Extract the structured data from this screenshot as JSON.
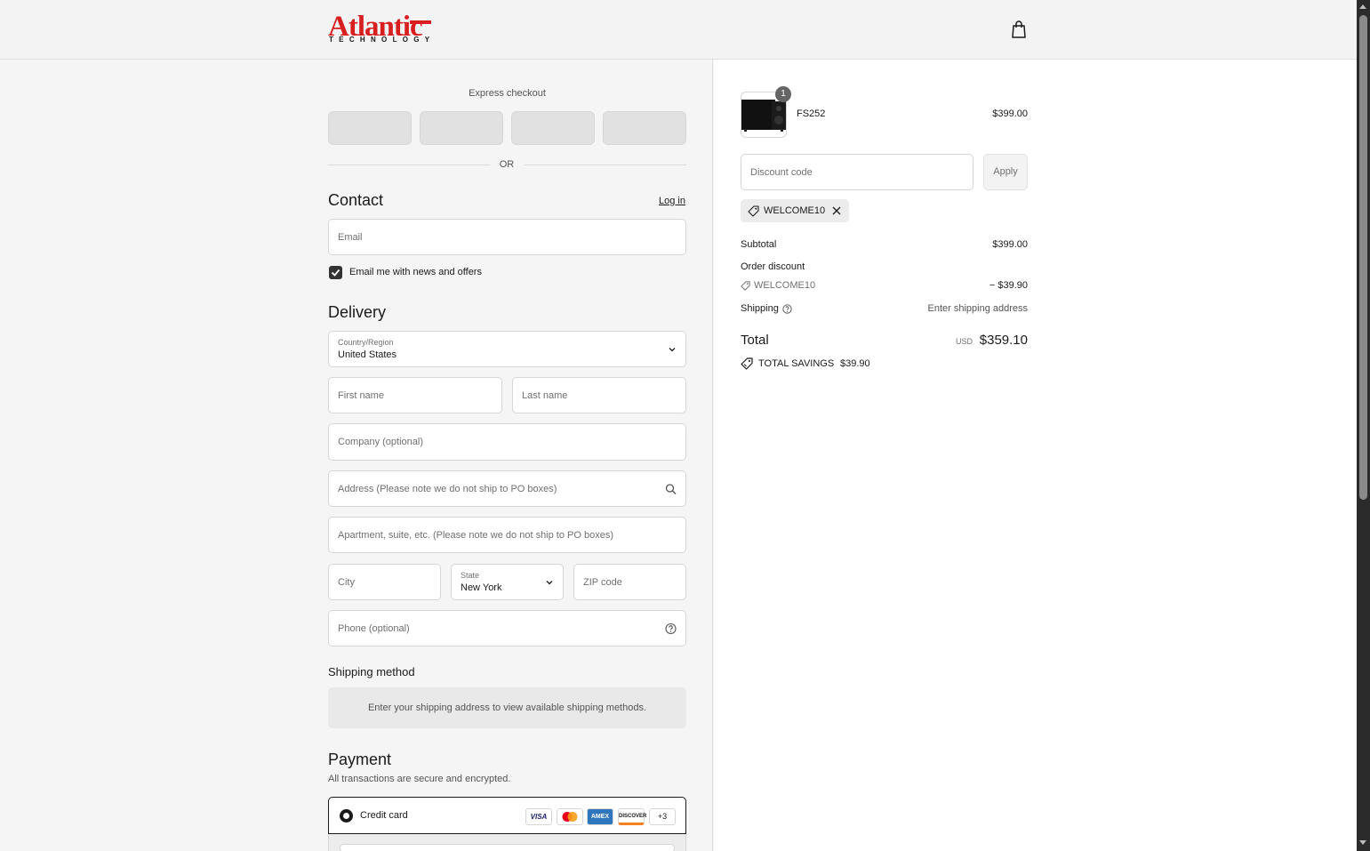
{
  "brand": {
    "name": "Atlantic",
    "tagline": "TECHNOLOGY"
  },
  "express": {
    "title": "Express checkout",
    "separator": "OR"
  },
  "contact": {
    "heading": "Contact",
    "login_link": "Log in",
    "email_placeholder": "Email",
    "newsletter_label": "Email me with news and offers",
    "newsletter_checked": true
  },
  "delivery": {
    "heading": "Delivery",
    "country_label": "Country/Region",
    "country_value": "United States",
    "first_name": "First name",
    "last_name": "Last name",
    "company": "Company (optional)",
    "address": "Address (Please note we do not ship to PO boxes)",
    "apartment": "Apartment, suite, etc. (Please note we do not ship to PO boxes)",
    "city": "City",
    "state_label": "State",
    "state_value": "New York",
    "zip": "ZIP code",
    "phone": "Phone (optional)"
  },
  "shipping_method": {
    "heading": "Shipping method",
    "message": "Enter your shipping address to view available shipping methods."
  },
  "payment": {
    "heading": "Payment",
    "subtitle": "All transactions are secure and encrypted.",
    "method_label": "Credit card",
    "cards": [
      "VISA",
      "MC",
      "AMEX",
      "DISCOVER"
    ],
    "more_cards": "+3"
  },
  "summary": {
    "product_name": "FS252",
    "product_price": "$399.00",
    "product_qty": "1",
    "discount_placeholder": "Discount code",
    "apply_label": "Apply",
    "applied_code": "WELCOME10",
    "subtotal_label": "Subtotal",
    "subtotal_value": "$399.00",
    "order_discount_label": "Order discount",
    "discount_code": "WELCOME10",
    "discount_value": "− $39.90",
    "shipping_label": "Shipping",
    "shipping_value": "Enter shipping address",
    "total_label": "Total",
    "currency": "USD",
    "total_value": "$359.10",
    "savings_label": "TOTAL SAVINGS",
    "savings_value": "$39.90"
  },
  "colors": {
    "accent": "#d81e1e",
    "checkbox": "#333333"
  }
}
